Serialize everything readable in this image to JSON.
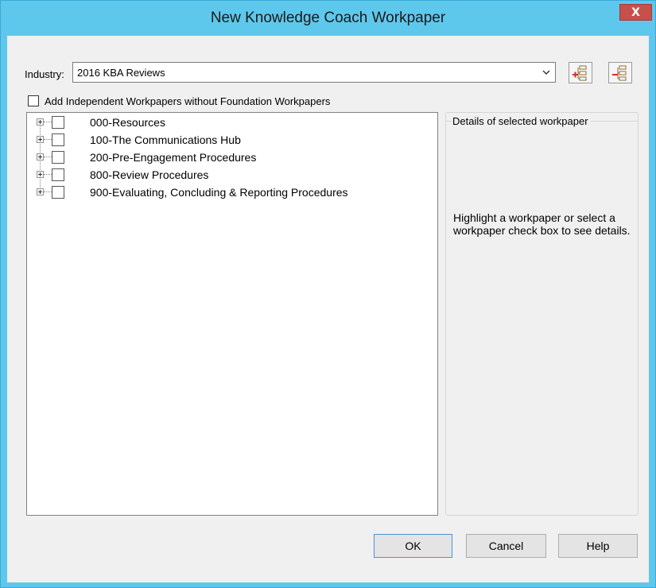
{
  "window": {
    "title": "New Knowledge Coach Workpaper",
    "close_label": "X"
  },
  "industry": {
    "label": "Industry:",
    "value": "2016 KBA Reviews"
  },
  "toolbar": {
    "expand_icon": "expand-tree-icon",
    "collapse_icon": "collapse-tree-icon"
  },
  "independent_checkbox": {
    "label": "Add Independent Workpapers without Foundation Workpapers",
    "checked": false
  },
  "tree": {
    "items": [
      {
        "label": "000-Resources"
      },
      {
        "label": "100-The Communications Hub"
      },
      {
        "label": "200-Pre-Engagement Procedures"
      },
      {
        "label": "800-Review Procedures"
      },
      {
        "label": "900-Evaluating, Concluding & Reporting Procedures"
      }
    ]
  },
  "details": {
    "title": "Details of selected workpaper",
    "body": "Highlight a workpaper or select a workpaper check box to see details."
  },
  "buttons": {
    "ok": "OK",
    "cancel": "Cancel",
    "help": "Help"
  },
  "colors": {
    "frame": "#5ec8ec",
    "close": "#c7504a",
    "icon_red": "#d0322b",
    "icon_brown": "#8a6a2c"
  }
}
